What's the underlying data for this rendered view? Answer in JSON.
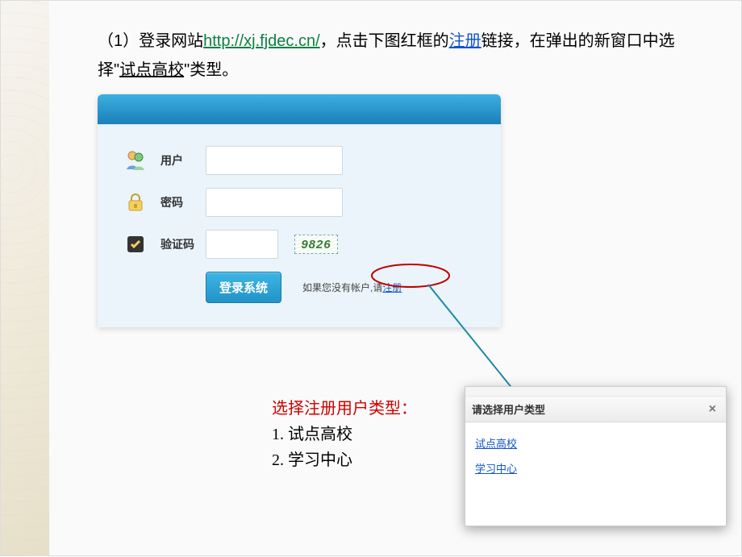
{
  "instruction": {
    "prefix": "（1）登录网站",
    "url": "http://xj.fjdec.cn/",
    "mid1": "，点击下图红框的",
    "register_word": "注册",
    "mid2": "链接，在弹出的新窗口中选择\"",
    "pilot_word": "试点高校",
    "suffix": "\"类型。"
  },
  "login": {
    "user_label": "用户",
    "pass_label": "密码",
    "captcha_label": "验证码",
    "captcha_value": "9826",
    "button_label": "登录系统",
    "hint_prefix": "如果您没有帐户,请",
    "hint_link": "注册"
  },
  "choose": {
    "title": "选择注册用户类型：",
    "item1": "1.  试点高校",
    "item2": "2.  学习中心"
  },
  "dialog": {
    "title": "请选择用户类型",
    "close": "×",
    "option1": "试点高校",
    "option2": "学习中心"
  }
}
